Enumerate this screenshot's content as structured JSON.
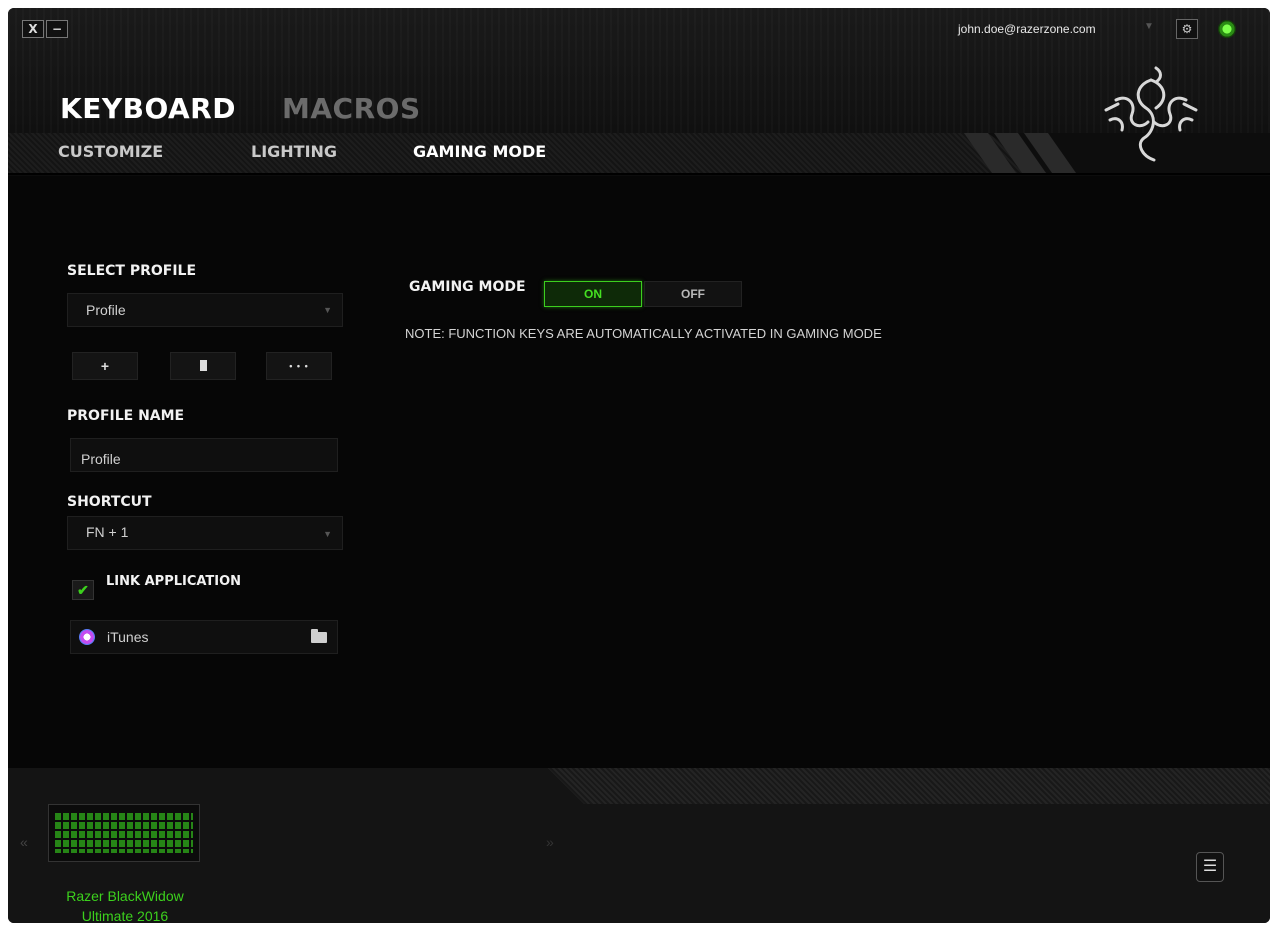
{
  "window": {
    "close_label": "X",
    "minimize_label": "−"
  },
  "account": {
    "email": "john.doe@razerzone.com"
  },
  "main_tabs": [
    {
      "label": "KEYBOARD",
      "active": true
    },
    {
      "label": "MACROS",
      "active": false
    }
  ],
  "sub_tabs": [
    {
      "label": "CUSTOMIZE",
      "active": false
    },
    {
      "label": "LIGHTING",
      "active": false
    },
    {
      "label": "GAMING MODE",
      "active": true
    }
  ],
  "profile": {
    "select_label": "SELECT PROFILE",
    "selected": "Profile",
    "add_label": "+",
    "more_label": "• • •",
    "name_label": "PROFILE NAME",
    "name_value": "Profile",
    "shortcut_label": "SHORTCUT",
    "shortcut_value": "FN + 1",
    "link_label": "LINK APPLICATION",
    "link_checked": true,
    "linked_app": "iTunes"
  },
  "gaming_mode": {
    "label": "GAMING MODE",
    "on_label": "ON",
    "off_label": "OFF",
    "state": "ON",
    "note": "NOTE: FUNCTION KEYS ARE AUTOMATICALLY ACTIVATED IN GAMING MODE"
  },
  "device": {
    "name_line1": "Razer BlackWidow",
    "name_line2": "Ultimate 2016"
  },
  "colors": {
    "accent": "#44d62c",
    "background": "#060606"
  }
}
